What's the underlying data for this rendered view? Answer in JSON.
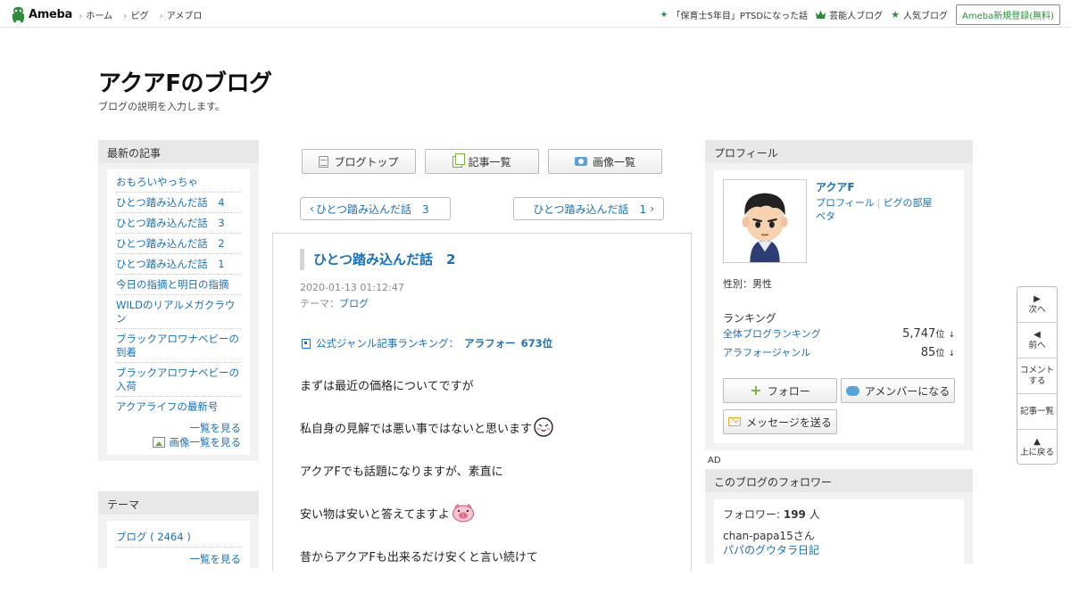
{
  "global_header": {
    "logo": "Ameba",
    "nav": [
      "ホーム",
      "ピグ",
      "アメブロ"
    ],
    "right_links": [
      {
        "label": "「保育士5年目」PTSDになった話",
        "icon": "sparkle-icon"
      },
      {
        "label": "芸能人ブログ",
        "icon": "crown-icon"
      },
      {
        "label": "人気ブログ",
        "icon": "star-icon"
      }
    ],
    "register": "Ameba新規登録(無料)"
  },
  "blog": {
    "title": "アクアFのブログ",
    "description": "ブログの説明を入力します。"
  },
  "recent": {
    "heading": "最新の記事",
    "items": [
      "おもろいやっちゃ",
      "ひとつ踏み込んだ話　4",
      "ひとつ踏み込んだ話　3",
      "ひとつ踏み込んだ話　2",
      "ひとつ踏み込んだ話　1",
      "今日の指摘と明日の指摘",
      "WILDのリアルメガクラウン",
      "ブラックアロワナベビーの到着",
      "ブラックアロワナベビーの入荷",
      "アクアライフの最新号"
    ],
    "see_all": "一覧を見る",
    "see_images": "画像一覧を見る"
  },
  "theme": {
    "heading": "テーマ",
    "items": [
      "ブログ ( 2464 )"
    ],
    "see_all": "一覧を見る"
  },
  "tabs": [
    {
      "label": "ブログトップ",
      "icon": "list-icon"
    },
    {
      "label": "記事一覧",
      "icon": "documents-icon"
    },
    {
      "label": "画像一覧",
      "icon": "camera-icon"
    }
  ],
  "pager": {
    "prev": "ひとつ踏み込んだ話　3",
    "next": "ひとつ踏み込んだ話　1"
  },
  "article": {
    "title": "ひとつ踏み込んだ話　2",
    "date": "2020-01-13 01:12:47",
    "theme_label": "テーマ：",
    "theme": "ブログ",
    "rank_label": "公式ジャンル記事ランキング：",
    "rank_genre": "アラフォー",
    "rank_value": "673位",
    "paragraphs": [
      {
        "text": "まずは最近の価格についてですが",
        "emoji": ""
      },
      {
        "text": "私自身の見解では悪い事ではないと思います",
        "emoji": "face-emoji"
      },
      {
        "text": "アクアFでも話題になりますが、素直に",
        "emoji": ""
      },
      {
        "text": "安い物は安いと答えてますよ",
        "emoji": "pig-emoji"
      },
      {
        "text": "昔からアクアFも出来るだけ安くと言い続けて",
        "emoji": ""
      }
    ]
  },
  "profile": {
    "heading": "プロフィール",
    "name": "アクアF",
    "links": [
      "プロフィール",
      "ピグの部屋",
      "ペタ"
    ],
    "gender": "性別：男性",
    "ranking_heading": "ランキング",
    "rankings": [
      {
        "label": "全体ブログランキング",
        "value": "5,747",
        "unit": "位",
        "trend": "↓"
      },
      {
        "label": "アラフォージャンル",
        "value": "85",
        "unit": "位",
        "trend": "↓"
      }
    ],
    "buttons": {
      "follow": "フォロー",
      "member": "アメンバーになる",
      "message": "メッセージを送る"
    }
  },
  "ad_label": "AD",
  "followers": {
    "heading": "このブログのフォロワー",
    "count_label": "フォロワー: ",
    "count": "199",
    "count_unit": " 人",
    "items": [
      {
        "name": "chan-papa15さん",
        "blog": "パパのグウタラ日記"
      }
    ]
  },
  "float_nav": [
    {
      "icon": "▶",
      "label": "次へ"
    },
    {
      "icon": "◀",
      "label": "前へ"
    },
    {
      "icon": "",
      "label": "コメント\nする"
    },
    {
      "icon": "",
      "label": "記事一覧"
    },
    {
      "icon": "▲",
      "label": "上に戻る"
    }
  ]
}
